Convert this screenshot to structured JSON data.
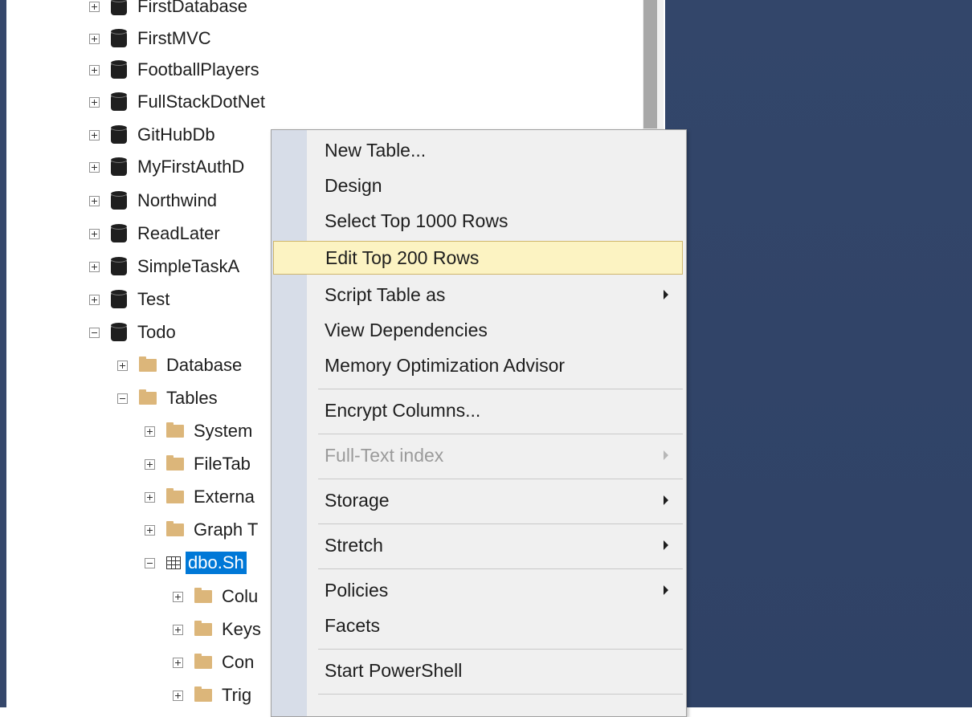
{
  "object_explorer": {
    "items": [
      {
        "label": "FirstDatabase",
        "type": "database",
        "expander": "plus"
      },
      {
        "label": "FirstMVC",
        "type": "database",
        "expander": "plus"
      },
      {
        "label": "FootballPlayers",
        "type": "database",
        "expander": "plus"
      },
      {
        "label": "FullStackDotNet",
        "type": "database",
        "expander": "plus"
      },
      {
        "label": "GitHubDb",
        "type": "database",
        "expander": "plus"
      },
      {
        "label": "MyFirstAuthD",
        "type": "database",
        "expander": "plus"
      },
      {
        "label": "Northwind",
        "type": "database",
        "expander": "plus"
      },
      {
        "label": "ReadLater",
        "type": "database",
        "expander": "plus"
      },
      {
        "label": "SimpleTaskA",
        "type": "database",
        "expander": "plus"
      },
      {
        "label": "Test",
        "type": "database",
        "expander": "plus"
      },
      {
        "label": "Todo",
        "type": "database",
        "expander": "minus"
      },
      {
        "label": "Database",
        "type": "folder",
        "expander": "plus"
      },
      {
        "label": "Tables",
        "type": "folder",
        "expander": "minus"
      },
      {
        "label": "System",
        "type": "folder",
        "expander": "plus"
      },
      {
        "label": "FileTab",
        "type": "folder",
        "expander": "plus"
      },
      {
        "label": "Externa",
        "type": "folder",
        "expander": "plus"
      },
      {
        "label": "Graph T",
        "type": "folder",
        "expander": "plus"
      },
      {
        "label": "dbo.Sh",
        "type": "table",
        "expander": "minus",
        "selected": true
      },
      {
        "label": "Colu",
        "type": "folder",
        "expander": "plus"
      },
      {
        "label": "Keys",
        "type": "folder",
        "expander": "plus"
      },
      {
        "label": "Con",
        "type": "folder",
        "expander": "plus"
      },
      {
        "label": "Trig",
        "type": "folder",
        "expander": "plus"
      }
    ]
  },
  "context_menu": {
    "items": [
      {
        "label": "New Table...",
        "has_submenu": false
      },
      {
        "label": "Design",
        "has_submenu": false
      },
      {
        "label": "Select Top 1000 Rows",
        "has_submenu": false
      },
      {
        "label": "Edit Top 200 Rows",
        "has_submenu": false,
        "highlighted": true
      },
      {
        "label": "Script Table as",
        "has_submenu": true
      },
      {
        "label": "View Dependencies",
        "has_submenu": false
      },
      {
        "label": "Memory Optimization Advisor",
        "has_submenu": false
      },
      {
        "label": "Encrypt Columns...",
        "has_submenu": false
      },
      {
        "label": "Full-Text index",
        "has_submenu": true,
        "disabled": true
      },
      {
        "label": "Storage",
        "has_submenu": true
      },
      {
        "label": "Stretch",
        "has_submenu": true
      },
      {
        "label": "Policies",
        "has_submenu": true
      },
      {
        "label": "Facets",
        "has_submenu": false
      },
      {
        "label": "Start PowerShell",
        "has_submenu": false
      }
    ]
  },
  "colors": {
    "selection": "#0078d7",
    "menu_highlight": "#fcf3c2",
    "background_panel": "#33466a",
    "folder": "#dcb67a"
  }
}
